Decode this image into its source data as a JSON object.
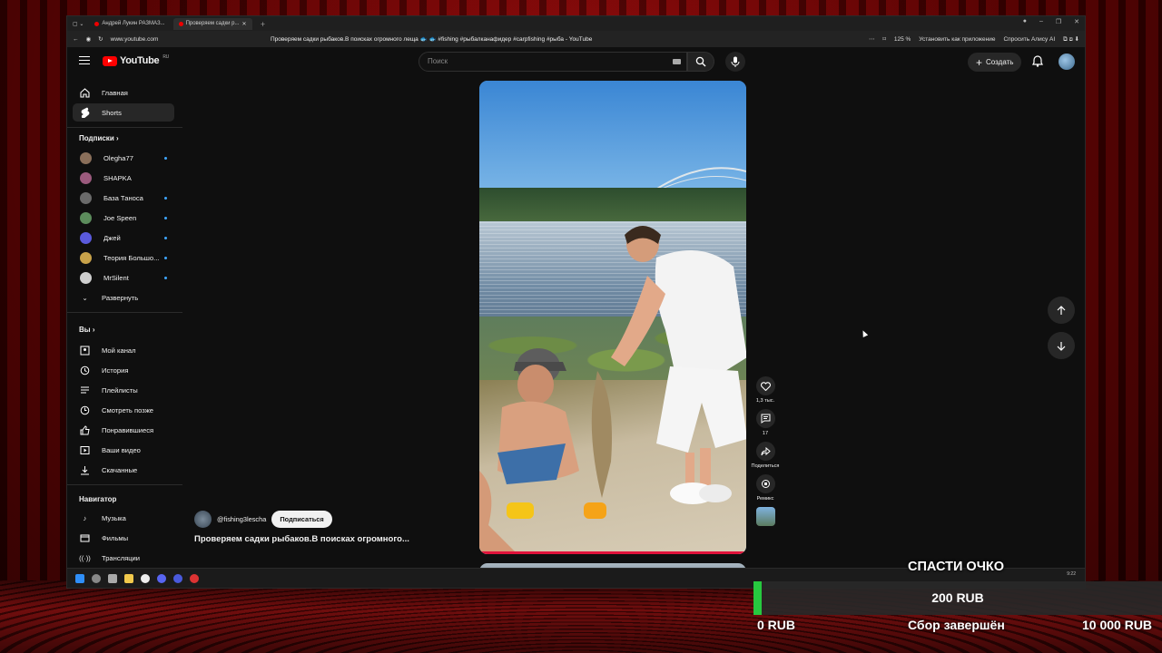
{
  "browser": {
    "tabs": [
      {
        "label": "Андрей Лукин РАЗМАЗ..."
      },
      {
        "label": "Проверяем садки р..."
      }
    ],
    "url": "www.youtube.com",
    "page_title": "Проверяем садки рыбаков.В поисках огромного леща 🐟 🐟 #fishing #рыбалканафидер #carpfishing #рыба - YouTube",
    "zoom": "125 %",
    "install_label": "Установить как приложение",
    "alice_label": "Спросить Алису AI"
  },
  "youtube": {
    "logo_text": "YouTube",
    "region": "RU",
    "search_placeholder": "Поиск",
    "create_label": "Создать",
    "sidebar": {
      "main": [
        {
          "label": "Главная",
          "icon": "home-icon"
        },
        {
          "label": "Shorts",
          "icon": "shorts-icon",
          "active": true
        }
      ],
      "subs_heading": "Подписки",
      "subscriptions": [
        {
          "label": "Olegha77",
          "live": true,
          "color": "#8a6f5a"
        },
        {
          "label": "SHAPKA",
          "live": false,
          "color": "#9b5a7d"
        },
        {
          "label": "База Таноса",
          "live": true,
          "color": "#6a6a6a"
        },
        {
          "label": "Joe Speen",
          "live": true,
          "color": "#5c8c5c"
        },
        {
          "label": "Джей",
          "live": true,
          "color": "#5a5adc"
        },
        {
          "label": "Теория Большо...",
          "live": true,
          "color": "#c8a24a"
        },
        {
          "label": "MrSilent",
          "live": true,
          "color": "#cfcfcf"
        }
      ],
      "expand_label": "Развернуть",
      "you_heading": "Вы",
      "you_items": [
        {
          "label": "Мой канал",
          "icon": "channel-icon"
        },
        {
          "label": "История",
          "icon": "history-icon"
        },
        {
          "label": "Плейлисты",
          "icon": "playlist-icon"
        },
        {
          "label": "Смотреть позже",
          "icon": "watch-later-icon"
        },
        {
          "label": "Понравившиеся",
          "icon": "like-icon"
        },
        {
          "label": "Ваши видео",
          "icon": "your-videos-icon"
        },
        {
          "label": "Скачанные",
          "icon": "download-icon"
        }
      ],
      "nav_heading": "Навигатор",
      "nav_items": [
        {
          "label": "Музыка",
          "icon": "music-icon"
        },
        {
          "label": "Фильмы",
          "icon": "movies-icon"
        },
        {
          "label": "Трансляции",
          "icon": "live-icon"
        }
      ]
    },
    "short": {
      "channel": "@fishing3lescha",
      "subscribe_label": "Подписаться",
      "title": "Проверяем садки рыбаков.В поисках огромного...",
      "likes": "1,3 тыс.",
      "comments": "17",
      "share_label": "Поделиться",
      "remix_label": "Ремикс"
    }
  },
  "taskbar": {
    "time": "9:22"
  },
  "donation": {
    "title": "СПАСТИ ОЧКО",
    "current": "200 RUB",
    "min": "0 RUB",
    "max": "10 000 RUB",
    "status": "Сбор завершён",
    "progress_fraction": 0.02,
    "accent": "#27c93f"
  }
}
